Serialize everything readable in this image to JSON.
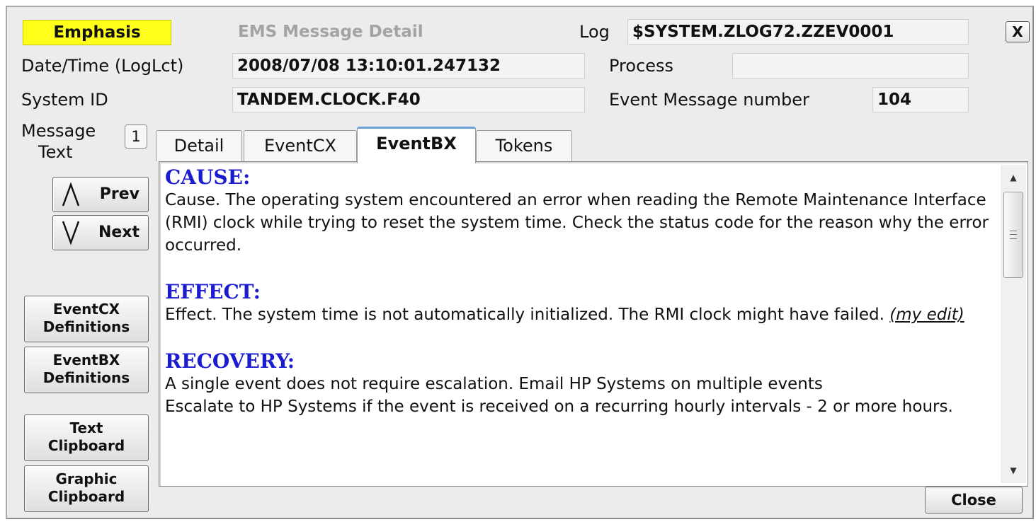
{
  "header": {
    "emphasis_label": "Emphasis",
    "title": "EMS Message Detail",
    "log_label": "Log",
    "log_value": "$SYSTEM.ZLOG72.ZZEV0001",
    "close_x_label": "X"
  },
  "fields": {
    "datetime_label": "Date/Time (LogLct)",
    "datetime_value": "2008/07/08 13:10:01.247132",
    "process_label": "Process",
    "process_value": "",
    "system_id_label": "System ID",
    "system_id_value": "TANDEM.CLOCK.F40",
    "event_number_label": "Event Message number",
    "event_number_value": "104"
  },
  "message": {
    "label_line1": "Message",
    "label_line2": "Text",
    "count": "1",
    "prev_label": "Prev",
    "next_label": "Next"
  },
  "left_buttons": {
    "eventcx_line1": "EventCX",
    "eventcx_line2": "Definitions",
    "eventbx_line1": "EventBX",
    "eventbx_line2": "Definitions",
    "text_clip_line1": "Text",
    "text_clip_line2": "Clipboard",
    "graphic_clip_line1": "Graphic",
    "graphic_clip_line2": "Clipboard"
  },
  "tabs": [
    {
      "label": "Detail",
      "active": false
    },
    {
      "label": "EventCX",
      "active": false
    },
    {
      "label": "EventBX",
      "active": true
    },
    {
      "label": "Tokens",
      "active": false
    }
  ],
  "content": {
    "cause_heading": "CAUSE:",
    "cause_text": "Cause.   The operating system encountered an error when reading the Remote Maintenance Interface (RMI) clock while trying to reset the system time. Check the status code for the reason why the error occurred.",
    "effect_heading": "EFFECT:",
    "effect_text": "Effect.   The system time is not automatically initialized. The RMI clock might have failed.",
    "effect_edit": "(my edit)",
    "recovery_heading": "RECOVERY:",
    "recovery_line1": "A single event does not require escalation. Email HP Systems on multiple events",
    "recovery_line2": "Escalate to HP Systems if the event is received on a recurring hourly intervals -  2 or more hours."
  },
  "footer": {
    "close_label": "Close"
  },
  "colors": {
    "emphasis_bg": "#ffff1a",
    "heading_blue": "#1b1bcf",
    "active_tab_accent": "#6fa0d8"
  }
}
